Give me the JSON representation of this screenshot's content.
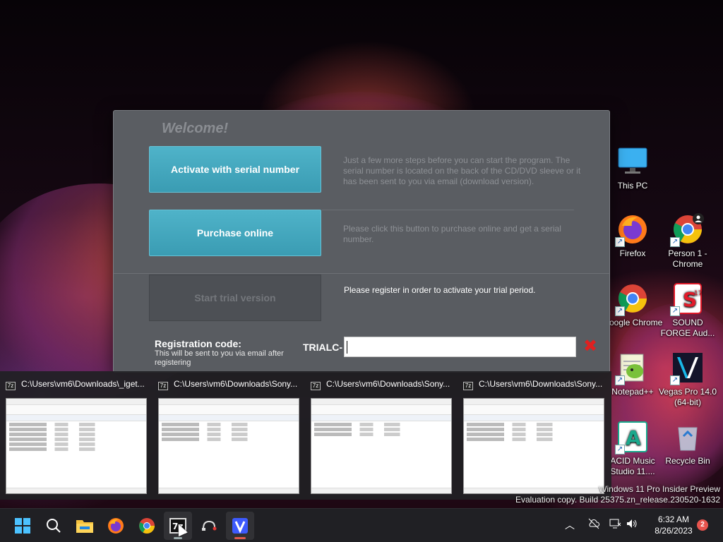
{
  "dialog": {
    "welcome": "Welcome!",
    "activate_label": "Activate with serial number",
    "activate_desc": "Just a few more steps before you can start the program. The serial number is located on the back of the CD/DVD sleeve or it has been sent to you via email (download version).",
    "purchase_label": "Purchase online",
    "purchase_desc": "Please click this button to purchase online and get a serial number.",
    "trial_label": "Start trial version",
    "trial_desc": "Please register in order to activate your trial period.",
    "reg_title": "Registration code:",
    "reg_sub": "This will be sent to you via email after registering",
    "reg_prefix": "TRIALC-",
    "reg_value": "",
    "clear_symbol": "✖"
  },
  "previews": [
    {
      "title": "C:\\Users\\vm6\\Downloads\\_iget..."
    },
    {
      "title": "C:\\Users\\vm6\\Downloads\\Sony..."
    },
    {
      "title": "C:\\Users\\vm6\\Downloads\\Sony..."
    },
    {
      "title": "C:\\Users\\vm6\\Downloads\\Sony..."
    }
  ],
  "desktop_icons": [
    {
      "label": "This PC",
      "icon": "monitor-icon"
    },
    {
      "label": "Firefox",
      "icon": "firefox-icon"
    },
    {
      "label": "Person 1 - Chrome",
      "icon": "chrome-icon"
    },
    {
      "label": "Google Chrome",
      "icon": "chrome-icon"
    },
    {
      "label": "SOUND FORGE Aud...",
      "icon": "soundforge-icon"
    },
    {
      "label": "Notepad++",
      "icon": "notepadpp-icon"
    },
    {
      "label": "Vegas Pro 14.0 (64-bit)",
      "icon": "vegas-icon"
    },
    {
      "label": "ACID Music Studio 11....",
      "icon": "acid-icon"
    },
    {
      "label": "Recycle Bin",
      "icon": "recycle-bin-icon"
    }
  ],
  "watermark": {
    "line1": "Windows 11 Pro Insider Preview",
    "line2": "Evaluation copy. Build 25375.zn_release.230520-1632"
  },
  "taskbar": {
    "items": [
      "start-icon",
      "search-icon",
      "file-explorer-icon",
      "firefox-icon",
      "chrome-icon",
      "7zip-icon",
      "cable-icon",
      "vegas-icon"
    ],
    "time": "6:32 AM",
    "date": "8/26/2023",
    "notification_count": "2"
  },
  "colors": {
    "accent_button": "#4fb3c9",
    "dialog_bg": "#5a5d62",
    "clear_red": "#e02020",
    "taskbar_bg": "#202024"
  }
}
